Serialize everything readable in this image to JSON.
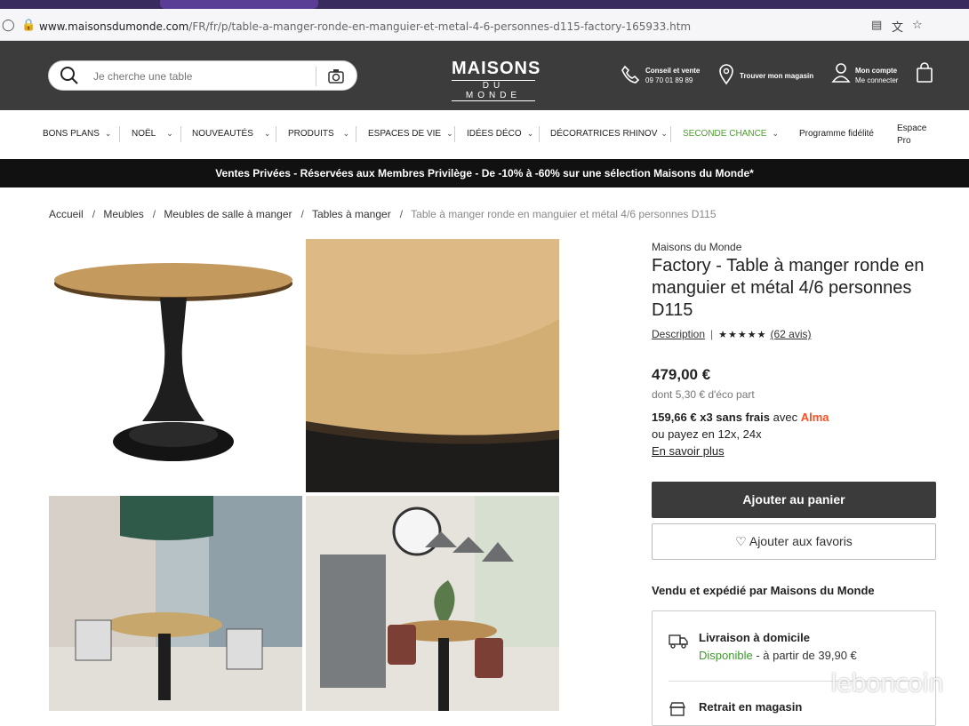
{
  "browser": {
    "url_domain": "www.maisonsdumonde.com",
    "url_path": "/FR/fr/p/table-a-manger-ronde-en-manguier-et-metal-4-6-personnes-d115-factory-165933.htm"
  },
  "header": {
    "search_placeholder": "Je cherche une table",
    "logo_line1": "MAISONS",
    "logo_line2": "DU MONDE",
    "contact_title": "Conseil et vente",
    "contact_phone": "09 70 01 89 89",
    "store_label": "Trouver mon magasin",
    "account_title": "Mon compte",
    "account_sub": "Me connecter"
  },
  "nav": {
    "items": [
      {
        "label": "BONS PLANS"
      },
      {
        "label": "NOËL"
      },
      {
        "label": "NOUVEAUTÉS"
      },
      {
        "label": "PRODUITS"
      },
      {
        "label": "ESPACES DE VIE"
      },
      {
        "label": "IDÉES DÉCO"
      },
      {
        "label": "DÉCORATRICES RHINOV"
      },
      {
        "label": "SECONDE CHANCE"
      }
    ],
    "fidelite": "Programme fidélité",
    "espace_pro_1": "Espace",
    "espace_pro_2": "Pro"
  },
  "promo": "Ventes Privées - Réservées aux Membres Privilège - De -10% à -60% sur une sélection Maisons du Monde*",
  "breadcrumb": [
    "Accueil",
    "Meubles",
    "Meubles de salle à manger",
    "Tables à manger",
    "Table à manger ronde en manguier et métal 4/6 personnes D115"
  ],
  "product": {
    "brand": "Maisons du Monde",
    "title": "Factory - Table à manger ronde en manguier et métal 4/6 personnes D115",
    "description_link": "Description",
    "rating": 4.5,
    "reviews": "(62 avis)",
    "price": "479,00 €",
    "eco": "dont 5,30 € d'éco part",
    "alma_amount": "159,66 € x3 sans frais",
    "alma_with": "avec",
    "alma_brand": "Alma",
    "alma_other": "ou payez en 12x, 24x",
    "alma_more": "En savoir plus",
    "add_to_cart": "Ajouter au panier",
    "add_to_fav": "Ajouter aux favoris",
    "seller": "Vendu et expédié par Maisons du Monde",
    "delivery_title": "Livraison à domicile",
    "delivery_status": "Disponible",
    "delivery_price": " - à partir de 39,90 €",
    "store_title": "Retrait en magasin"
  },
  "watermark": "leboncoin",
  "colors": {
    "header": "#3c3c3c",
    "promo": "#111111",
    "alma": "#fa5022",
    "available": "#3e9a2c",
    "seconde_chance": "#4aa02c"
  }
}
